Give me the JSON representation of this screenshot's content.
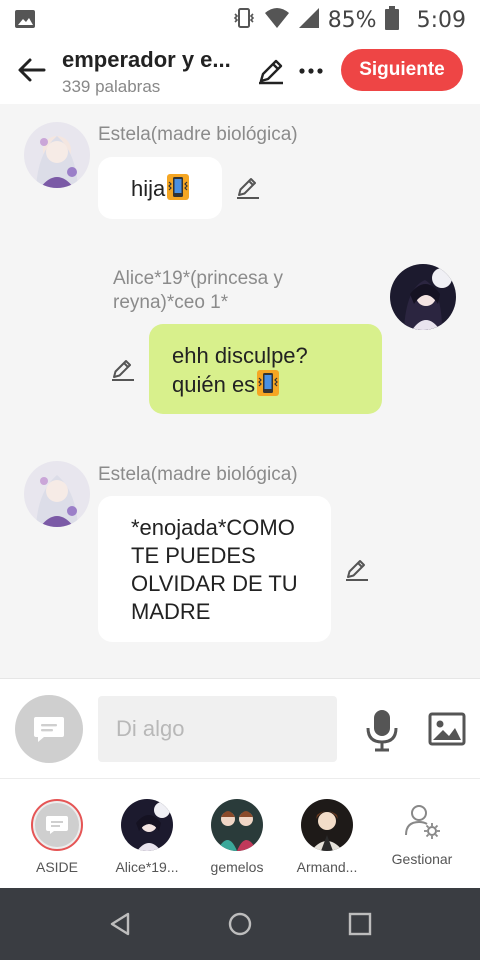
{
  "status_bar": {
    "battery": "85%",
    "time": "5:09",
    "icons": [
      "image-icon",
      "vibrate-icon",
      "wifi-icon",
      "signal-icon",
      "battery-icon"
    ]
  },
  "header": {
    "title": "emperador y e...",
    "subtitle": "339 palabras",
    "next_label": "Siguiente",
    "accent_color": "#ee4545"
  },
  "messages": [
    {
      "sender": "Estela(madre biológica)",
      "text": "hija",
      "emoji": "vibration-mode",
      "side": "left"
    },
    {
      "sender": "Alice*19*(princesa y reyna)*ceo 1*",
      "sender_lines": [
        "Alice*19*(princesa y",
        "reyna)*ceo 1*"
      ],
      "text_lines": [
        "ehh disculpe?",
        "quién es"
      ],
      "emoji": "vibration-mode",
      "side": "right"
    },
    {
      "sender": "Estela(madre biológica)",
      "text_lines": [
        "*enojada*COMO",
        "TE PUEDES",
        "OLVIDAR DE TU",
        "MADRE"
      ],
      "side": "left"
    }
  ],
  "input": {
    "placeholder": "Di algo"
  },
  "characters": [
    {
      "label": "ASIDE",
      "selected": true
    },
    {
      "label": "Alice*19..."
    },
    {
      "label": "gemelos"
    },
    {
      "label": "Armand..."
    },
    {
      "label": "Gestionar"
    }
  ],
  "colors": {
    "right_bubble": "#d8f08c",
    "left_bubble": "#ffffff",
    "nav_bar": "#3a3d42"
  }
}
